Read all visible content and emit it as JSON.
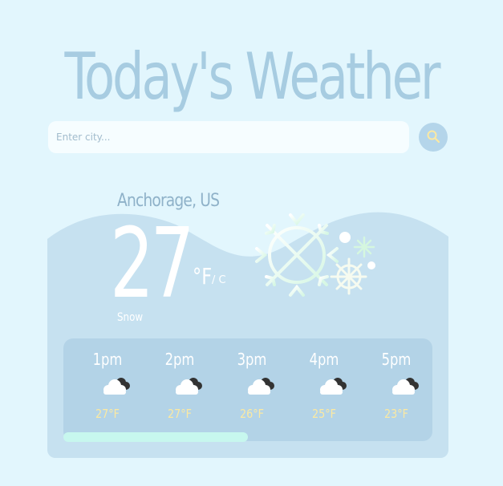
{
  "app": {
    "title": "Today's Weather"
  },
  "search": {
    "placeholder": "Enter city...",
    "value": "",
    "button_icon": "search-icon"
  },
  "current": {
    "location": "Anchorage, US",
    "temperature": "27",
    "unit_primary": "°F",
    "unit_secondary": "/ C",
    "condition": "Snow",
    "icon": "snowflake-icon"
  },
  "hourly": [
    {
      "time": "1pm",
      "icon": "cloudy-icon",
      "temp": "27°F"
    },
    {
      "time": "2pm",
      "icon": "cloudy-icon",
      "temp": "27°F"
    },
    {
      "time": "3pm",
      "icon": "cloudy-icon",
      "temp": "26°F"
    },
    {
      "time": "4pm",
      "icon": "cloudy-icon",
      "temp": "25°F"
    },
    {
      "time": "5pm",
      "icon": "cloudy-icon",
      "temp": "23°F"
    }
  ],
  "scroll": {
    "position_fraction": 0.5
  },
  "colors": {
    "background": "#e2f6fd",
    "card": "#b3d3e7",
    "accent_temp": "#fbe9a2",
    "title": "#a7cce1",
    "scroll_thumb": "#c7f7ee"
  }
}
